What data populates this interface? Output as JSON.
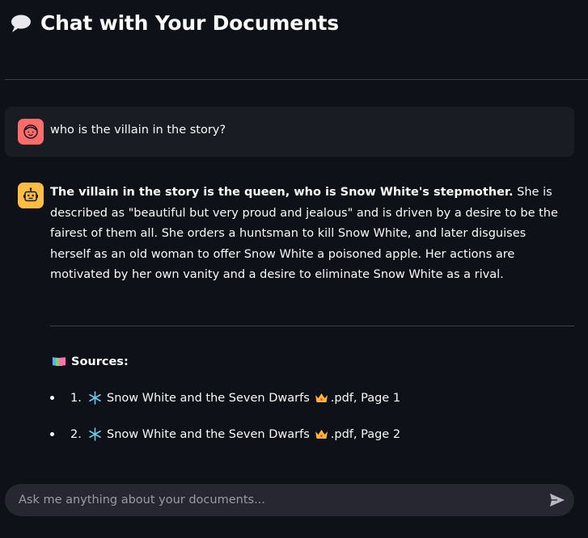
{
  "header": {
    "title": "Chat with Your Documents",
    "icon": "speech-balloon-icon"
  },
  "messages": [
    {
      "role": "user",
      "avatar": "user-face-icon",
      "text": "who is the villain in the story?"
    },
    {
      "role": "assistant",
      "avatar": "robot-icon",
      "bold_text": "The villain in the story is the queen, who is Snow White's stepmother.",
      "text": " She is described as \"beautiful but very proud and jealous\" and is driven by a desire to be the fairest of them all. She orders a huntsman to kill Snow White, and later disguises herself as an old woman to offer Snow White a poisoned apple. Her actions are motivated by her own vanity and a desire to eliminate Snow White as a rival.",
      "sources_heading": "Sources:",
      "sources_icon": "books-icon",
      "sources": [
        {
          "number": "1.",
          "title": "Snow White and the Seven Dwarfs",
          "suffix": ".pdf, Page 1"
        },
        {
          "number": "2.",
          "title": "Snow White and the Seven Dwarfs",
          "suffix": ".pdf, Page 2"
        }
      ]
    }
  ],
  "chat_input": {
    "placeholder": "Ask me anything about your documents...",
    "value": ""
  },
  "colors": {
    "background": "#0e1117",
    "user_avatar": "#ff6c6c",
    "bot_avatar": "#ffbd45",
    "input_bg": "#262730"
  }
}
